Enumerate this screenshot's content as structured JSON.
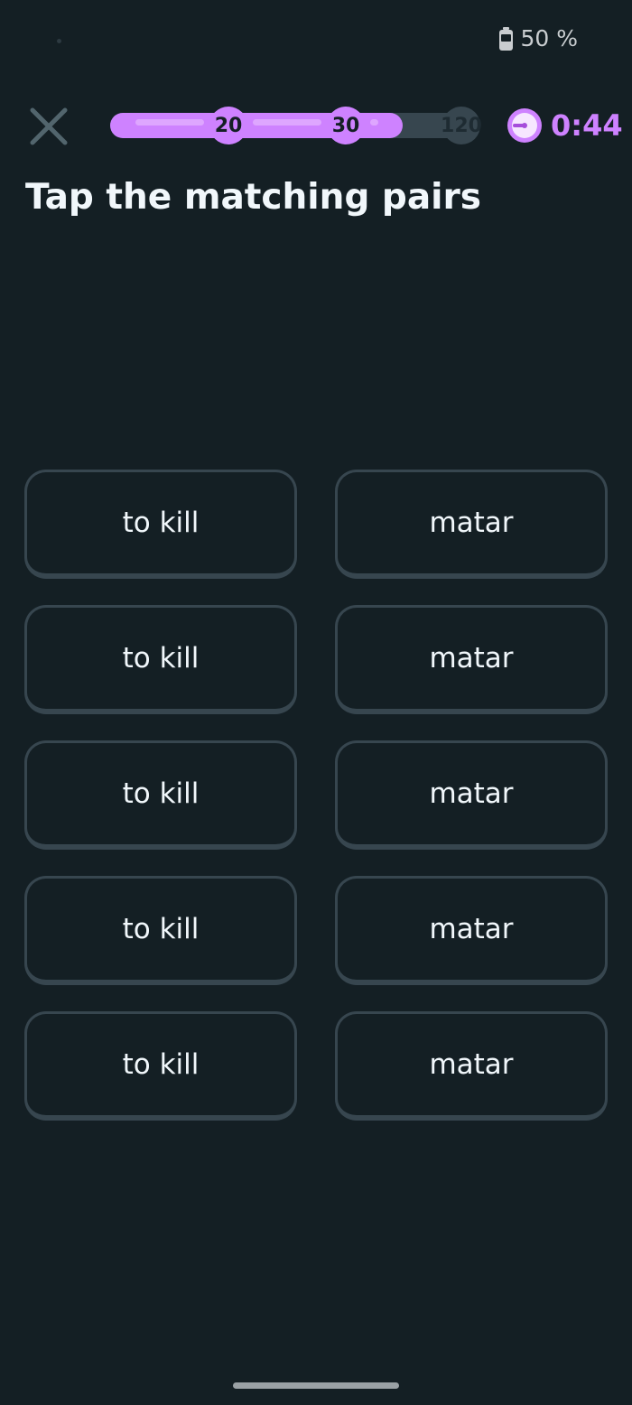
{
  "status_bar": {
    "battery_text": "50 %",
    "battery_level": 0.5
  },
  "header": {
    "close_icon": "close-x-icon",
    "timer_icon": "stopwatch-icon",
    "timer_value": "0:44",
    "progress": {
      "fill_fraction": 0.79,
      "milestones": [
        {
          "label": "20",
          "reached": true
        },
        {
          "label": "30",
          "reached": true
        },
        {
          "label": "120",
          "reached": false
        }
      ]
    }
  },
  "instruction": "Tap the matching pairs",
  "pairs": {
    "left": [
      "to kill",
      "to kill",
      "to kill",
      "to kill",
      "to kill"
    ],
    "right": [
      "matar",
      "matar",
      "matar",
      "matar",
      "matar"
    ]
  },
  "colors": {
    "background": "#141f24",
    "accent": "#ce82ff",
    "tile_border": "#37464f",
    "text": "#f1f7fb"
  }
}
